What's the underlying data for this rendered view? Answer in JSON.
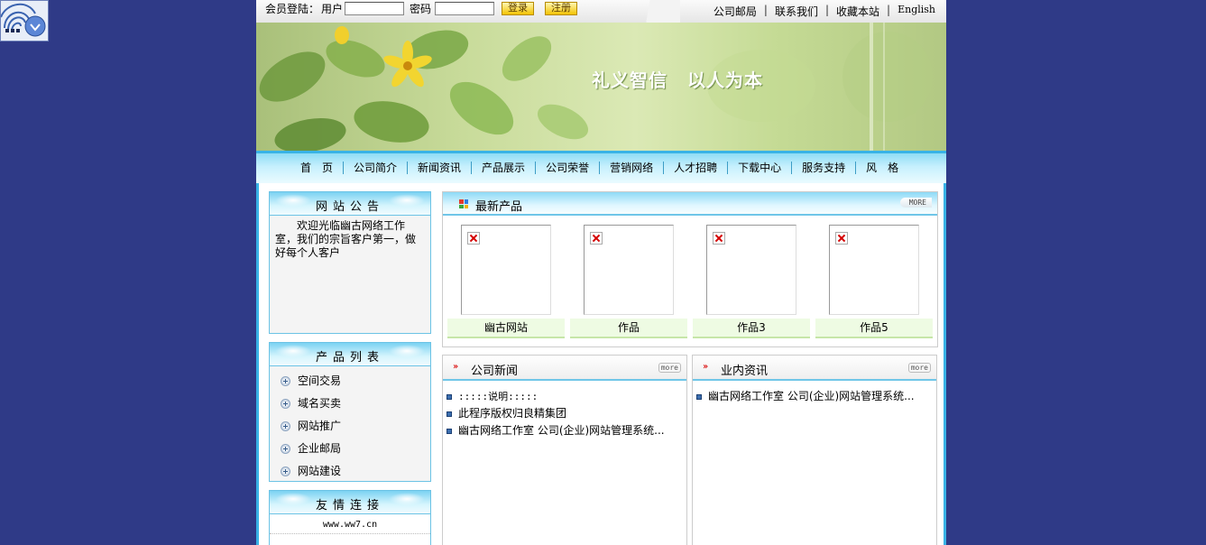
{
  "login": {
    "member_label": "会员登陆：",
    "user_label": "用户",
    "user_value": "",
    "pass_label": "密码",
    "pass_value": "",
    "login_btn": "登录",
    "register_btn": "注册"
  },
  "toplinks": [
    "公司邮局",
    "联系我们",
    "收藏本站",
    "English"
  ],
  "banner": {
    "slogan_a": "礼义智信",
    "slogan_b": "以人为本"
  },
  "nav": [
    "首　页",
    "公司简介",
    "新闻资讯",
    "产品展示",
    "公司荣誉",
    "营销网络",
    "人才招聘",
    "下载中心",
    "服务支持",
    "风　格"
  ],
  "notice": {
    "title": "网站公告",
    "text": "欢迎光临幽古网络工作室，我们的宗旨客户第一，做好每个人客户"
  },
  "product_list": {
    "title": "产品列表",
    "items": [
      "空间交易",
      "域名买卖",
      "网站推广",
      "企业邮局",
      "网站建设"
    ]
  },
  "friends": {
    "title": "友情连接",
    "links": [
      "www.ww7.cn"
    ]
  },
  "latest": {
    "title": "最新产品",
    "more": "MORE",
    "items": [
      "幽古网站",
      "作品",
      "作品3",
      "作品5"
    ]
  },
  "company_news": {
    "title": "公司新闻",
    "more": "more",
    "items": [
      ":::::说明:::::",
      "此程序版权归良精集团",
      "幽古网络工作室 公司(企业)网站管理系统..."
    ]
  },
  "industry_news": {
    "title": "业内资讯",
    "more": "more",
    "items": [
      "幽古网络工作室 公司(企业)网站管理系统..."
    ]
  },
  "colors": {
    "background": "#2f3a87",
    "accent": "#39b3e6"
  }
}
